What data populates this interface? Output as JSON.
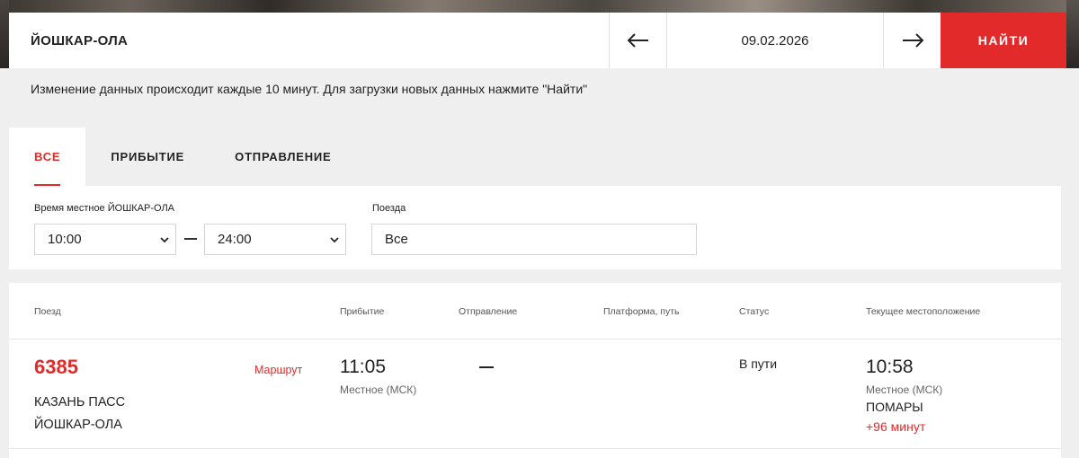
{
  "search": {
    "city": "ЙОШКАР-ОЛА",
    "date": "09.02.2026",
    "find_label": "НАЙТИ",
    "prev_icon": "arrow-left-icon",
    "next_icon": "arrow-right-icon"
  },
  "notice": "Изменение данных происходит каждые 10 минут. Для загрузки новых данных нажмите \"Найти\"",
  "tabs": [
    {
      "label": "ВСЕ",
      "active": true
    },
    {
      "label": "ПРИБЫТИЕ",
      "active": false
    },
    {
      "label": "ОТПРАВЛЕНИЕ",
      "active": false
    }
  ],
  "filters": {
    "time_label": "Время местное ЙОШКАР-ОЛА",
    "time_from": "10:00",
    "time_to": "24:00",
    "trains_label": "Поезда",
    "trains_value": "Все"
  },
  "table": {
    "headers": {
      "train": "Поезд",
      "arrival": "Прибытие",
      "departure": "Отправление",
      "platform": "Платформа, путь",
      "status": "Статус",
      "location": "Текущее местоположение"
    },
    "rows": [
      {
        "number": "6385",
        "route_link": "Маршрут",
        "from": "КАЗАНЬ ПАСС",
        "to": "ЙОШКАР-ОЛА",
        "arrival_time": "11:05",
        "arrival_note": "Местное (МСК)",
        "departure": "—",
        "platform": "",
        "status": "В пути",
        "location_time": "10:58",
        "location_note": "Местное (МСК)",
        "location_station": "ПОМАРЫ",
        "delay": "+96 минут"
      }
    ]
  },
  "colors": {
    "accent": "#e32a2a",
    "background": "#efefef",
    "panel": "#ffffff"
  }
}
